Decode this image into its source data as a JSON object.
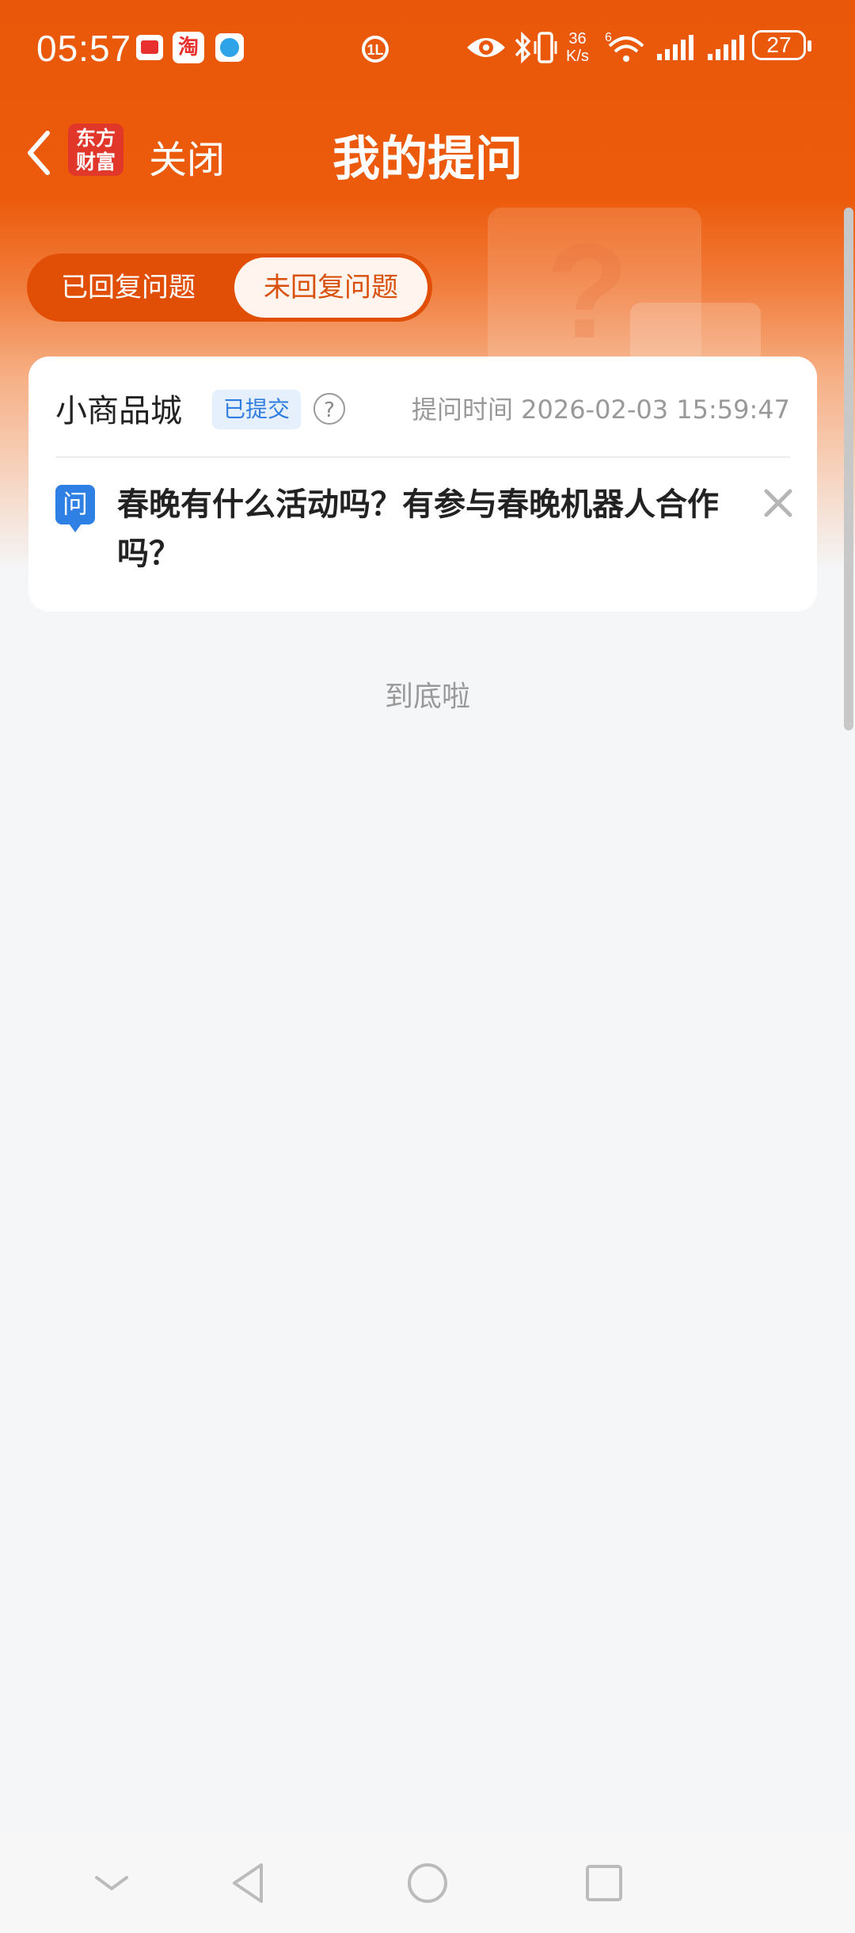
{
  "status_bar": {
    "time": "05:57",
    "net_speed_value": "36",
    "net_speed_unit": "K/s",
    "battery": "27",
    "icons": [
      "notification-app-icon",
      "taobao-icon",
      "browser-icon",
      "sync-icon",
      "eye-icon",
      "bluetooth-icon",
      "vibrate-icon",
      "wifi-icon",
      "signal-icon",
      "signal-icon-2",
      "battery-icon"
    ]
  },
  "nav": {
    "logo_line1": "东方",
    "logo_line2": "财富",
    "close_label": "关闭",
    "title": "我的提问"
  },
  "tabs": [
    {
      "label": "已回复问题",
      "active": false
    },
    {
      "label": "未回复问题",
      "active": true
    }
  ],
  "questions": [
    {
      "shop": "小商品城",
      "status": "已提交",
      "help": "?",
      "time_label": "提问时间 2026-02-03 15:59:47",
      "q_badge": "问",
      "text": "春晚有什么活动吗？有参与春晚机器人合作吗？"
    }
  ],
  "footer": {
    "end_text": "到底啦"
  },
  "colors": {
    "brand": "#e9570a",
    "badge_bg": "#e6f0fd",
    "badge_text": "#2f7de0"
  }
}
